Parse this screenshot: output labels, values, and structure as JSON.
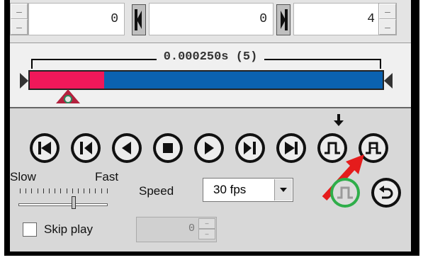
{
  "frame_values": {
    "start": "0",
    "current": "0",
    "end": "4"
  },
  "timeline": {
    "duration_label": "0.000250s (5)",
    "progress_fraction": 0.21
  },
  "speed": {
    "slow_label": "Slow",
    "fast_label": "Fast",
    "speed_label": "Speed",
    "fps_value": "30 fps",
    "slider_fraction": 0.62
  },
  "skip": {
    "label": "Skip play",
    "value": "0"
  },
  "colors": {
    "progress": "#f0185a",
    "track": "#0b62b0",
    "loop_ring": "#2fae4a",
    "pointer_arrow": "#e51c1c"
  },
  "icons": [
    "first-frame-icon",
    "step-back-icon",
    "play-back-icon",
    "stop-icon",
    "play-icon",
    "step-forward-icon",
    "last-frame-icon",
    "pulse-icon",
    "pulse-toggle-icon",
    "loop-pulse-icon",
    "loop-icon",
    "down-arrow-icon",
    "red-arrow-icon"
  ]
}
